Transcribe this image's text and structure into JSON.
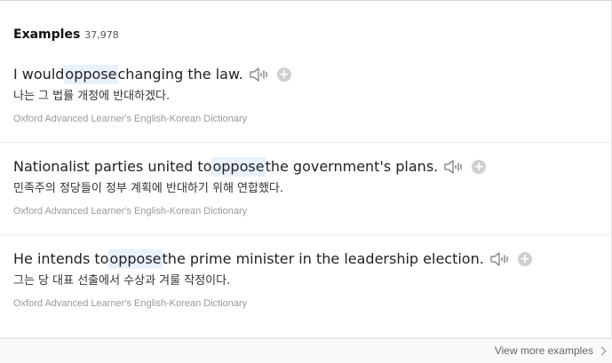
{
  "header": {
    "title": "Examples",
    "count": "37,978"
  },
  "examples": [
    {
      "before": "I would ",
      "highlight": "oppose",
      "after": " changing the law.",
      "translation": "나는 그 법률 개정에 반대하겠다.",
      "source": "Oxford Advanced Learner's English-Korean Dictionary",
      "audio_icon": "speaker-icon",
      "add_icon": "plus-icon"
    },
    {
      "before": "Nationalist parties united to ",
      "highlight": "oppose",
      "after": " the government's plans.",
      "translation": "민족주의 정당들이 정부 계획에 반대하기 위해 연합했다.",
      "source": "Oxford Advanced Learner's English-Korean Dictionary",
      "audio_icon": "speaker-icon",
      "add_icon": "plus-icon"
    },
    {
      "before": "He intends to ",
      "highlight": "oppose",
      "after": " the prime minister in the leadership election.",
      "translation": "그는 당 대표 선출에서 수상과 겨룰 작정이다.",
      "source": "Oxford Advanced Learner's English-Korean Dictionary",
      "audio_icon": "speaker-icon",
      "add_icon": "plus-icon"
    }
  ],
  "footer": {
    "view_more_label": "View more examples",
    "chevron_icon": "chevron-right-icon"
  },
  "colors": {
    "highlight": "#e8f1fc",
    "source_text": "#999999",
    "add_button": "#cfcfcf"
  }
}
